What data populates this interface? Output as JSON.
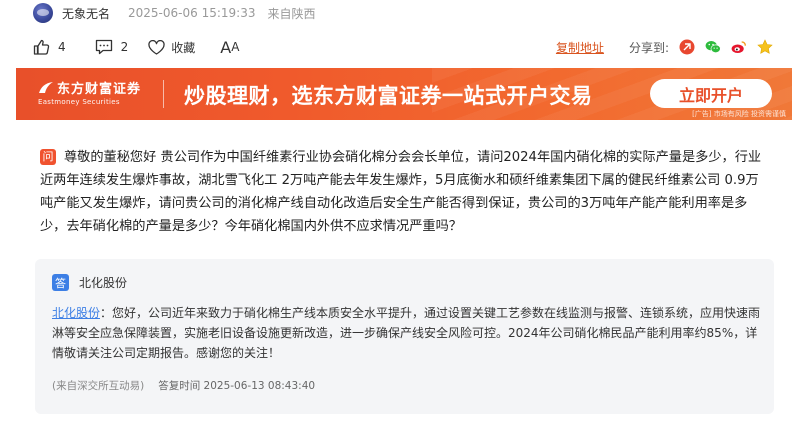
{
  "meta": {
    "author": "无象无名",
    "time": "2025-06-06 15:19:33",
    "source": "来自陕西"
  },
  "actions": {
    "like_count": "4",
    "comment_count": "2",
    "favorite_label": "收藏",
    "font_size_label": "A",
    "font_size_label_small": "A",
    "copy_link_label": "复制地址",
    "share_label": "分享到:"
  },
  "banner": {
    "brand_cn": "东方财富证券",
    "brand_en": "Eastmoney Securities",
    "slogan": "炒股理财，选东方财富证券一站式开户交易",
    "button_label": "立即开户",
    "ad_note": "[广告] 市场有风险 投资需谨慎"
  },
  "question": {
    "badge": "问",
    "text": "尊敬的董秘您好 贵公司作为中国纤维素行业协会硝化棉分会会长单位，请问2024年国内硝化棉的实际产量是多少，行业近两年连续发生爆炸事故，湖北雪飞化工 2万吨产能去年发生爆炸，5月底衡水和硕纤维素集团下属的健民纤维素公司 0.9万吨产能又发生爆炸，请问贵公司的消化棉产线自动化改造后安全生产能否得到保证，贵公司的3万吨年产能产能利用率是多少，去年硝化棉的产量是多少？今年硝化棉国内外供不应求情况严重吗？"
  },
  "answer": {
    "badge": "答",
    "company": "北化股份",
    "mention": "北化股份",
    "text": "：您好，公司近年来致力于硝化棉生产线本质安全水平提升，通过设置关键工艺参数在线监测与报警、连锁系统，应用快速雨淋等安全应急保障装置，实施老旧设备设施更新改造，进一步确保产线安全风险可控。2024年公司硝化棉民品产能利用率约85%，详情敬请关注公司定期报告。感谢您的关注！",
    "source": "(来自深交所互动易)",
    "reply_time": "答复时间 2025-06-13 08:43:40"
  },
  "colors": {
    "accent_orange": "#e8502a",
    "answer_blue": "#3d7fe5",
    "answer_bg": "#f4f5f7"
  },
  "icons": {
    "like": "thumbs-up-icon",
    "comment": "comment-icon",
    "favorite": "heart-icon",
    "share_toutiao": "toutiao-icon",
    "share_wechat": "wechat-icon",
    "share_weibo": "weibo-icon",
    "share_qzone": "qzone-star-icon"
  }
}
